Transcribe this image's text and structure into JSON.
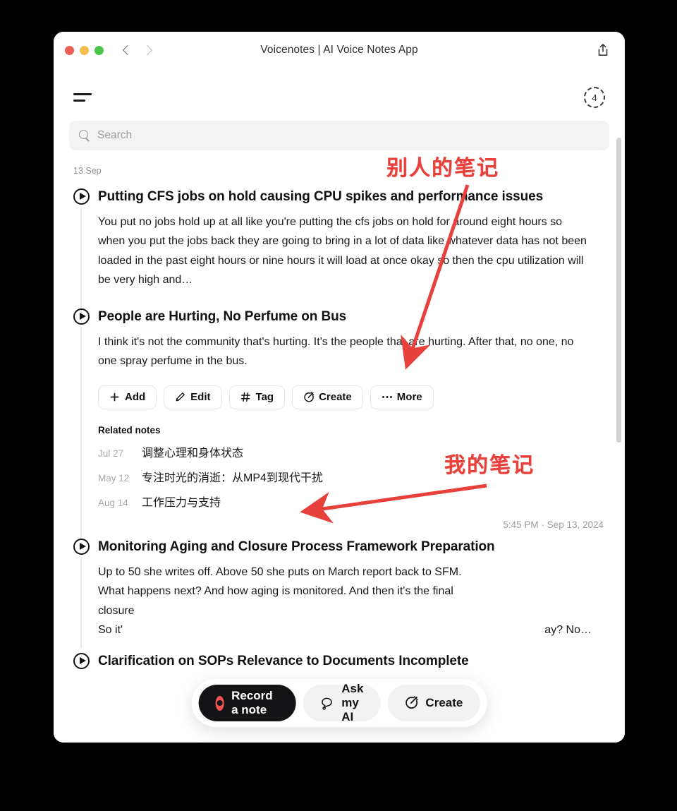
{
  "window": {
    "title": "Voicenotes | AI Voice Notes App",
    "share_icon": "share-icon",
    "back_icon": "chevron-left-icon",
    "forward_icon": "chevron-right-icon"
  },
  "topbar": {
    "menu_icon": "menu-icon",
    "badge_count": "4"
  },
  "search": {
    "placeholder": "Search",
    "icon": "search-icon"
  },
  "list": {
    "date_group": "13 Sep"
  },
  "notes": [
    {
      "title": "Putting CFS jobs on hold causing CPU spikes and performance issues",
      "body": "You put no jobs hold up at all like you're putting the cfs jobs on hold for around eight hours so when you put the jobs back they are going to bring in a lot of data like whatever data has not been loaded in the past eight hours or nine hours it will load at once okay so then the cpu utilization will be very high and…"
    },
    {
      "title": "People are Hurting, No Perfume on Bus",
      "body": "I think it's not the community that's hurting. It's the people that are hurting. After that, no one, no one spray perfume in the bus.",
      "timestamp": "5:45 PM · Sep 13, 2024"
    },
    {
      "title": "Monitoring Aging and Closure Process Framework Preparation",
      "body_line1": "Up to 50 she writes off. Above 50 she puts on March report back to SFM.",
      "body_line2": "What happens next? And how aging is monitored. And then it's the final",
      "body_line3": "closure",
      "body_line4_start": "So it'",
      "body_line4_end": "ay? No…"
    },
    {
      "title": "Clarification on SOPs Relevance to Documents Incomplete"
    }
  ],
  "chips": [
    {
      "label": "Add",
      "icon": "plus-icon"
    },
    {
      "label": "Edit",
      "icon": "pencil-icon"
    },
    {
      "label": "Tag",
      "icon": "hash-icon"
    },
    {
      "label": "Create",
      "icon": "magic-wand-icon"
    },
    {
      "label": "More",
      "icon": "ellipsis-icon"
    }
  ],
  "related": {
    "heading": "Related notes",
    "items": [
      {
        "date": "Jul 27",
        "text": "调整心理和身体状态"
      },
      {
        "date": "May 12",
        "text": "专注时光的消逝：从MP4到现代干扰"
      },
      {
        "date": "Aug 14",
        "text": "工作压力与支持"
      }
    ]
  },
  "toolbar": {
    "record_label": "Record a note",
    "ask_label": "Ask my AI",
    "create_label": "Create",
    "record_icon": "record-dot-icon",
    "ask_icon": "chat-bubble-icon",
    "create_icon": "magic-wand-icon"
  },
  "annotations": [
    {
      "text": "别人的笔记",
      "meaning": "other-peoples-notes"
    },
    {
      "text": "我的笔记",
      "meaning": "my-notes"
    }
  ],
  "colors": {
    "annotation_red": "#e8403a",
    "record_red": "#f05252",
    "window_bg": "#ffffff",
    "page_bg": "#000000"
  }
}
